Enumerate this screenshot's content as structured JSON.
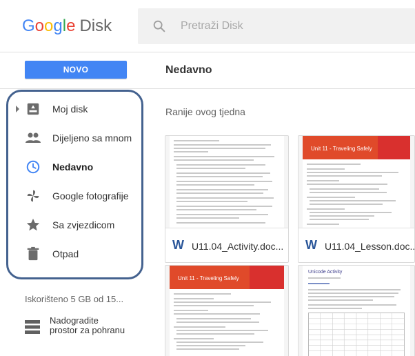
{
  "header": {
    "logo_letters": [
      "G",
      "o",
      "o",
      "g",
      "l",
      "e"
    ],
    "logo_colors": [
      "#4285f4",
      "#ea4335",
      "#fbbc05",
      "#4285f4",
      "#34a853",
      "#ea4335"
    ],
    "product": "Disk",
    "search": {
      "placeholder": "Pretraži Disk",
      "icon": "search-icon"
    }
  },
  "toolbar": {
    "new_label": "NOVO",
    "new_color": "#4285f4",
    "title": "Nedavno"
  },
  "sidebar": {
    "items": [
      {
        "label": "Moj disk",
        "icon": "drive-icon",
        "active": false
      },
      {
        "label": "Dijeljeno sa mnom",
        "icon": "people-icon",
        "active": false
      },
      {
        "label": "Nedavno",
        "icon": "clock-icon",
        "active": true
      },
      {
        "label": "Google fotografije",
        "icon": "photos-pinwheel-icon",
        "active": false
      },
      {
        "label": "Sa zvjezdicom",
        "icon": "star-icon",
        "active": false
      },
      {
        "label": "Otpad",
        "icon": "trash-icon",
        "active": false
      }
    ],
    "highlight_color": "#44628f",
    "storage": "Iskorišteno 5 GB od 15...",
    "upgrade_line1": "Nadogradite",
    "upgrade_line2": "prostor za pohranu"
  },
  "main": {
    "section_title": "Ranije ovog tjedna",
    "files": [
      {
        "name": "U11.04_Activity.doc...",
        "type": "word-icon",
        "thumb": "plain"
      },
      {
        "name": "U11.04_Lesson.doc...",
        "type": "word-icon",
        "thumb": "banner",
        "banner_title": "Unit 11 - Traveling Safely"
      },
      {
        "name": "",
        "type": "",
        "thumb": "banner",
        "banner_title": "Unit 11 - Traveling Safely"
      },
      {
        "name": "",
        "type": "",
        "thumb": "table",
        "heading": "Unicode Activity"
      }
    ]
  }
}
